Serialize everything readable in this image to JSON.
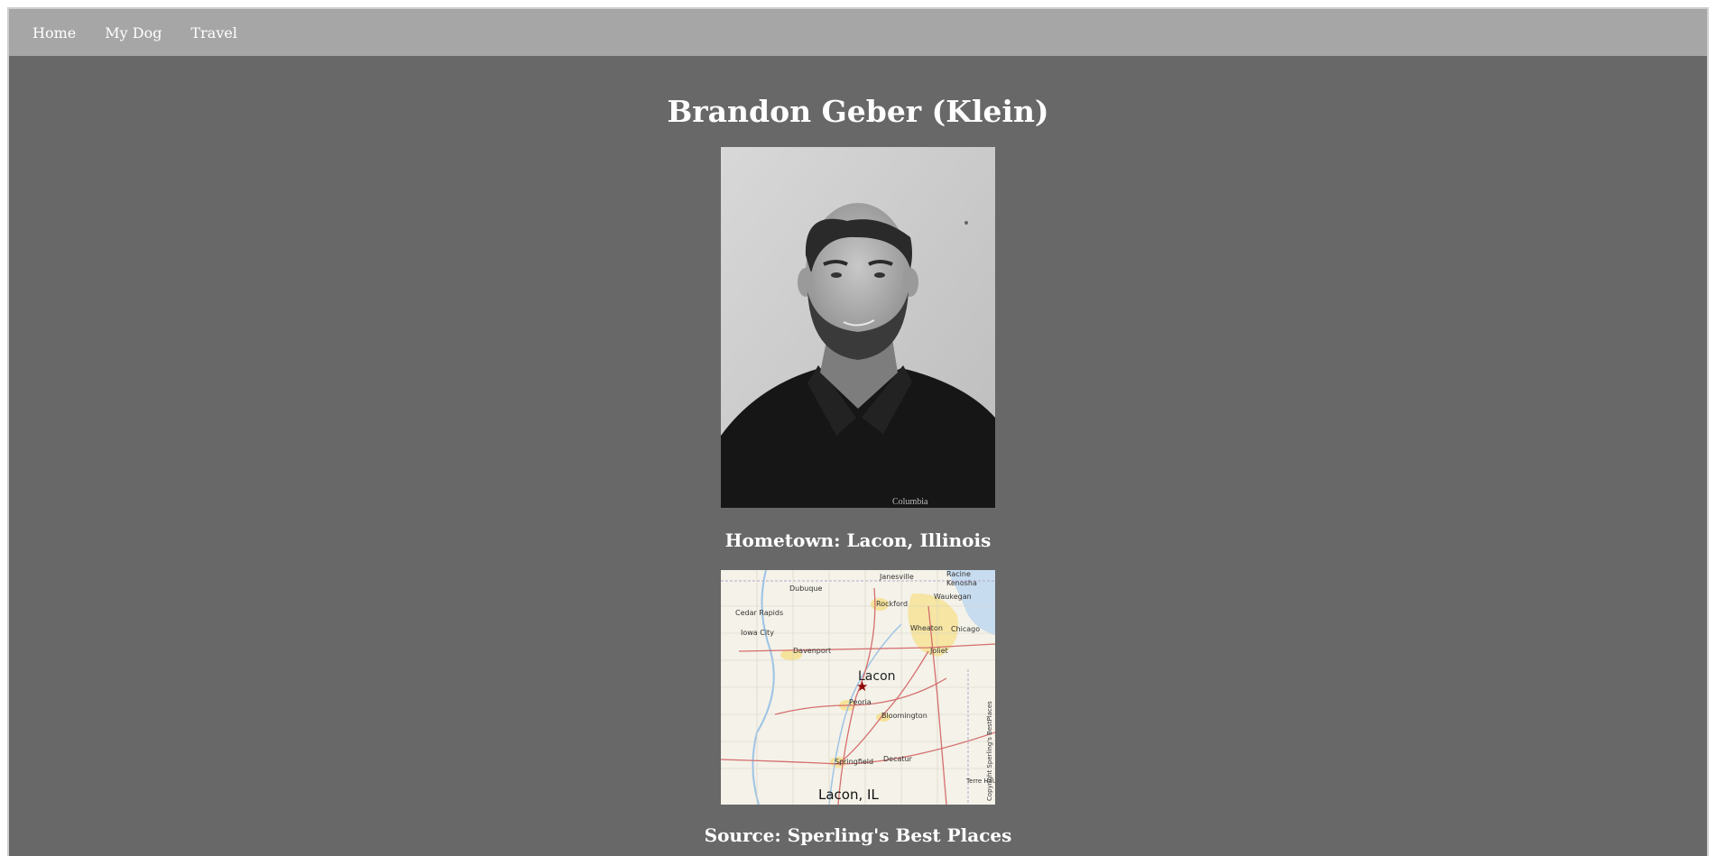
{
  "nav": {
    "items": [
      {
        "label": "Home"
      },
      {
        "label": "My Dog"
      },
      {
        "label": "Travel"
      }
    ]
  },
  "main": {
    "title": "Brandon Geber (Klein)",
    "hometown": "Hometown: Lacon, Illinois",
    "source": "Source: Sperling's Best Places",
    "photo_logo_text": "Columbia"
  },
  "map": {
    "title": "Lacon, IL",
    "center_label": "Lacon",
    "copyright": "Copyright Sperling's BestPlaces",
    "cities": [
      "Janesville",
      "Racine",
      "Kenosha",
      "Dubuque",
      "Rockford",
      "Waukegan",
      "Cedar Rapids",
      "Iowa City",
      "Wheaton",
      "Chicago",
      "Davenport",
      "Joliet",
      "Peoria",
      "Bloomington",
      "Springfield",
      "Decatur",
      "Terre Haute"
    ]
  },
  "colors": {
    "page_bg": "#686868",
    "nav_bg": "#a6a6a6",
    "text": "#ffffff"
  }
}
